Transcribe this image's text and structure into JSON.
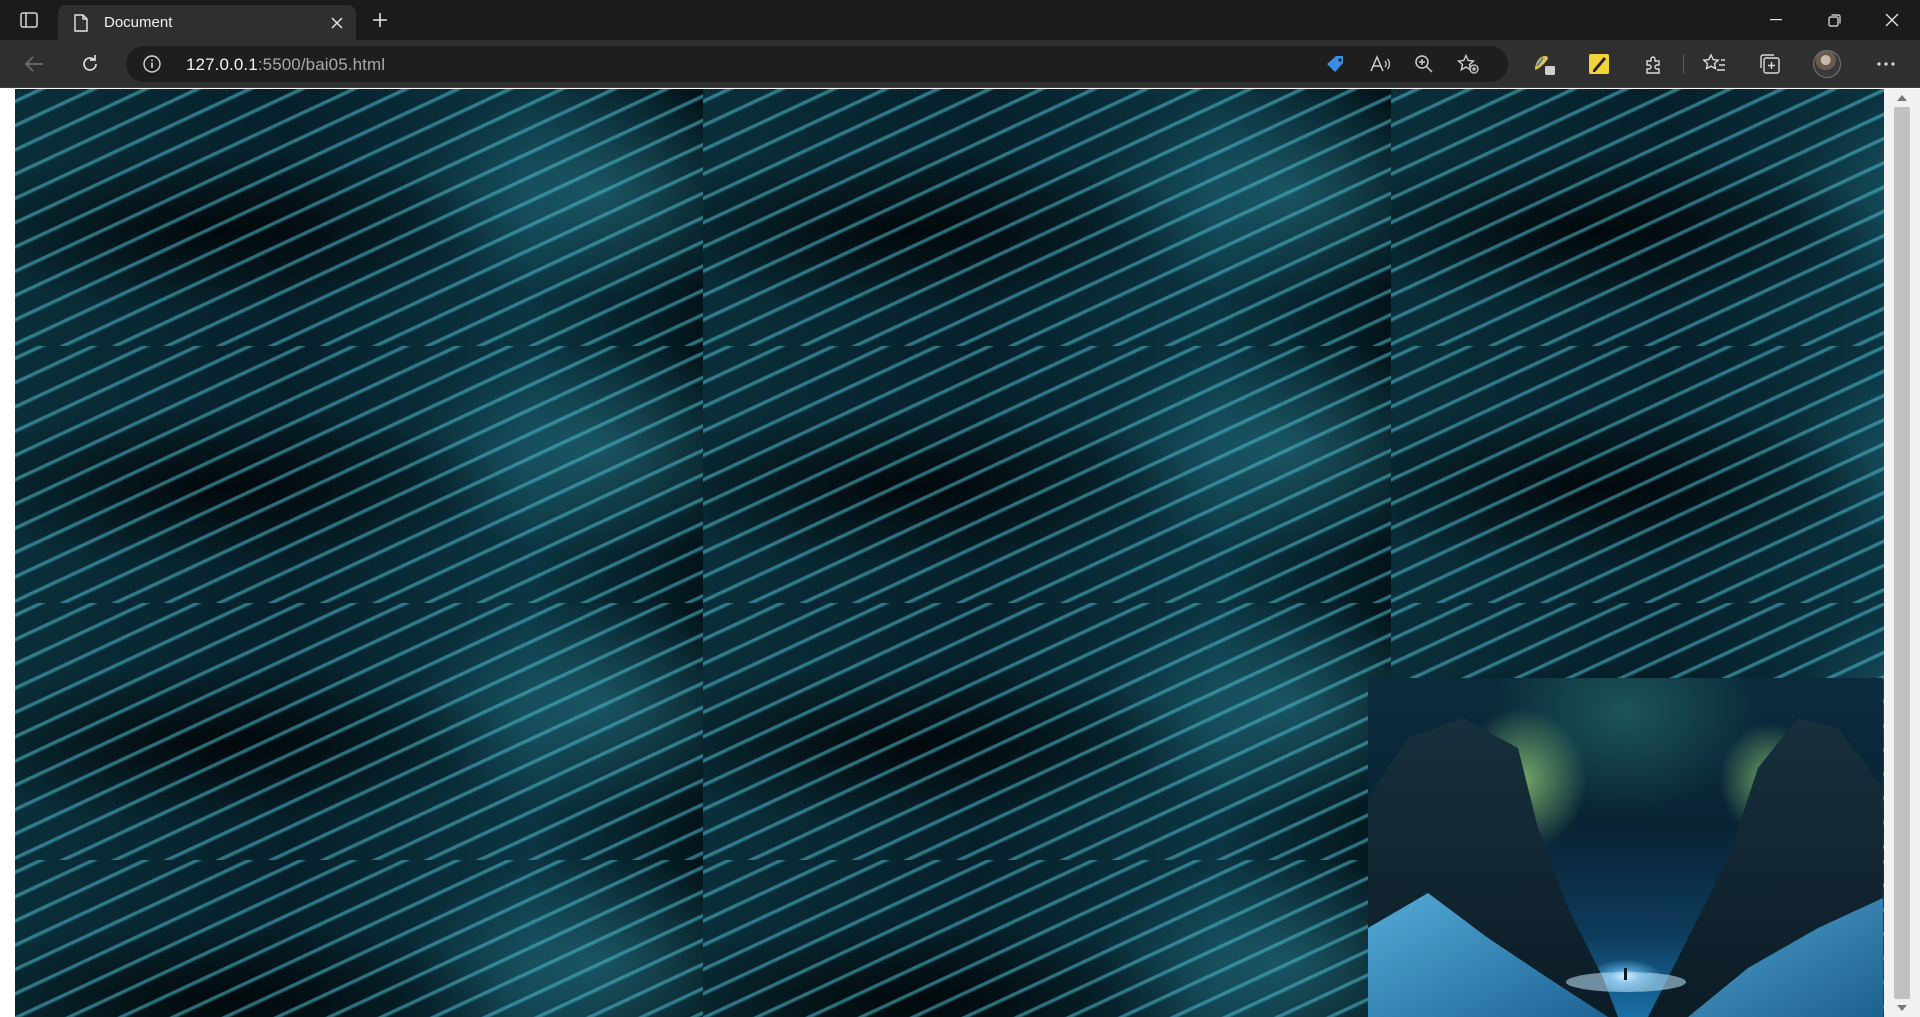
{
  "browser": {
    "tab": {
      "title": "Document"
    },
    "address": {
      "host": "127.0.0.1",
      "rest": ":5500/bai05.html"
    }
  },
  "page": {
    "background_image": "wave-pattern-teal",
    "overlay_image": "aurora-night-mountains"
  },
  "colors": {
    "chrome_dark": "#1b1b1b",
    "toolbar": "#2f2f2f",
    "wave_teal": "#3fa9bd"
  }
}
